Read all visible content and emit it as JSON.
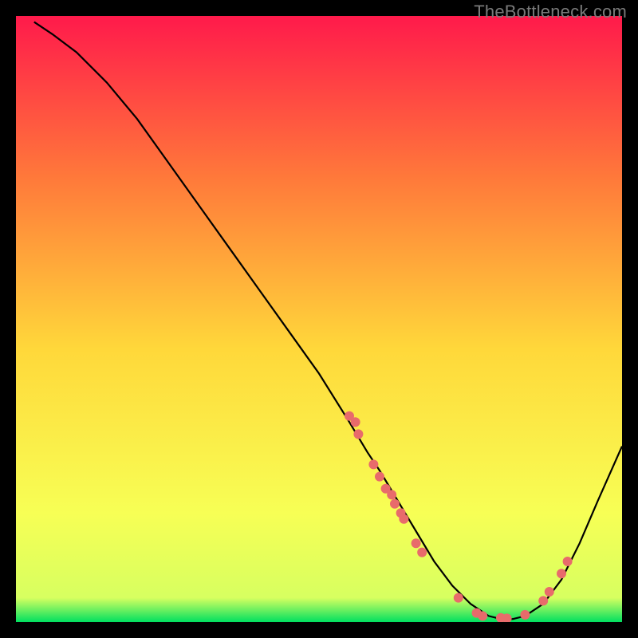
{
  "watermark": "TheBottleneck.com",
  "chart_data": {
    "type": "line",
    "title": "",
    "xlabel": "",
    "ylabel": "",
    "xlim": [
      0,
      100
    ],
    "ylim": [
      0,
      100
    ],
    "grid": false,
    "legend": false,
    "background_gradient": {
      "top": "#ff1a4b",
      "upper_mid": "#ff7a3a",
      "mid": "#ffd83a",
      "lower_mid": "#f7ff55",
      "bottom": "#00e060"
    },
    "series": [
      {
        "name": "bottleneck-curve",
        "x": [
          3,
          6,
          10,
          15,
          20,
          25,
          30,
          35,
          40,
          45,
          50,
          55,
          58,
          60,
          63,
          66,
          69,
          72,
          75,
          78,
          80,
          82,
          84,
          87,
          90,
          93,
          96,
          100
        ],
        "y": [
          99,
          97,
          94,
          89,
          83,
          76,
          69,
          62,
          55,
          48,
          41,
          33,
          28,
          25,
          20,
          15,
          10,
          6,
          3,
          1,
          0.5,
          0.5,
          1,
          3,
          7,
          13,
          20,
          29
        ]
      }
    ],
    "scatter_points": {
      "name": "data-dots",
      "color": "#e86b6b",
      "radius": 6,
      "points": [
        {
          "x": 55,
          "y": 34
        },
        {
          "x": 56,
          "y": 33
        },
        {
          "x": 56.5,
          "y": 31
        },
        {
          "x": 59,
          "y": 26
        },
        {
          "x": 60,
          "y": 24
        },
        {
          "x": 61,
          "y": 22
        },
        {
          "x": 62,
          "y": 21
        },
        {
          "x": 62.5,
          "y": 19.5
        },
        {
          "x": 63.5,
          "y": 18
        },
        {
          "x": 64,
          "y": 17
        },
        {
          "x": 66,
          "y": 13
        },
        {
          "x": 67,
          "y": 11.5
        },
        {
          "x": 73,
          "y": 4
        },
        {
          "x": 76,
          "y": 1.5
        },
        {
          "x": 77,
          "y": 1
        },
        {
          "x": 80,
          "y": 0.7
        },
        {
          "x": 81,
          "y": 0.6
        },
        {
          "x": 84,
          "y": 1.2
        },
        {
          "x": 87,
          "y": 3.5
        },
        {
          "x": 88,
          "y": 5
        },
        {
          "x": 90,
          "y": 8
        },
        {
          "x": 91,
          "y": 10
        }
      ]
    }
  }
}
